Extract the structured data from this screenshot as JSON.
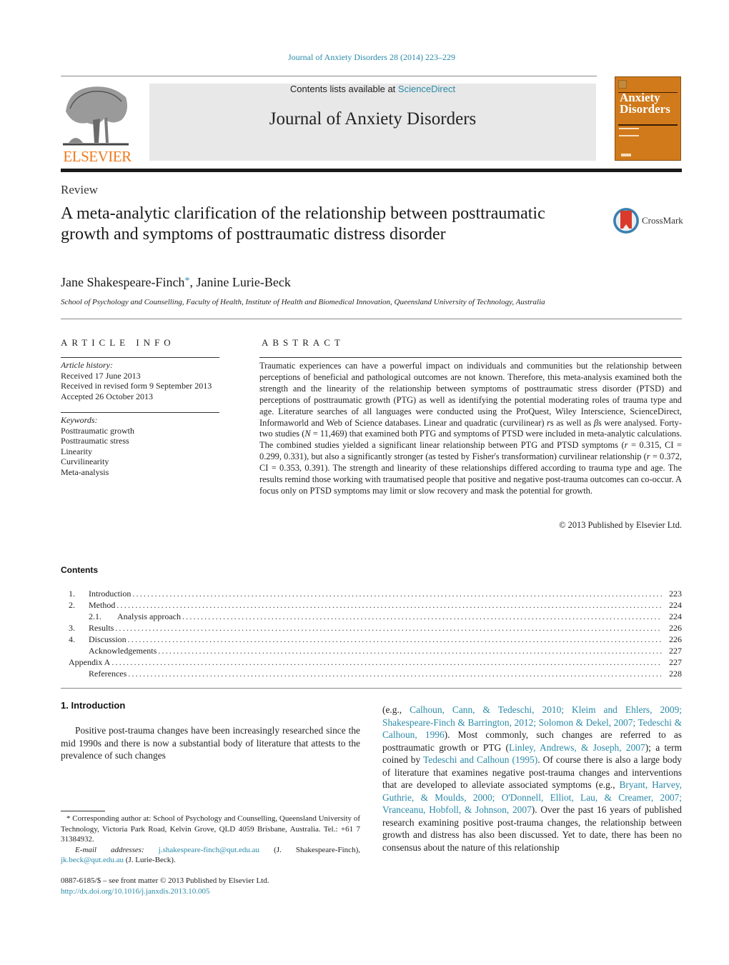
{
  "header": {
    "citation": "Journal of Anxiety Disorders 28 (2014) 223–229",
    "contents_prefix": "Contents lists available at ",
    "contents_link": "ScienceDirect",
    "journal_title": "Journal of Anxiety Disorders",
    "publisher_logo": "ELSEVIER",
    "cover": {
      "line1": "Anxiety",
      "line2": "Disorders",
      "color": "#d17a1b"
    }
  },
  "article": {
    "type": "Review",
    "title": "A meta-analytic clarification of the relationship between posttraumatic growth and symptoms of posttraumatic distress disorder",
    "crossmark_label": "CrossMark",
    "authors": [
      {
        "name": "Jane Shakespeare-Finch",
        "mark": "*"
      },
      {
        "name": "Janine Lurie-Beck",
        "mark": ""
      }
    ],
    "author_separator": ", ",
    "affiliation": "School of Psychology and Counselling, Faculty of Health, Institute of Health and Biomedical Innovation, Queensland University of Technology, Australia"
  },
  "article_info": {
    "heading": "ARTICLE INFO",
    "history_label": "Article history:",
    "history": [
      "Received 17 June 2013",
      "Received in revised form 9 September 2013",
      "Accepted 26 October 2013"
    ],
    "keywords_label": "Keywords:",
    "keywords": [
      "Posttraumatic growth",
      "Posttraumatic stress",
      "Linearity",
      "Curvilinearity",
      "Meta-analysis"
    ]
  },
  "abstract": {
    "heading": "ABSTRACT",
    "parts": [
      "Traumatic experiences can have a powerful impact on individuals and communities but the rela­tionship between perceptions of beneficial and pathological outcomes are not known. Therefore, this meta-analysis examined both the strength and the linearity of the relationship between symptoms of posttraumatic stress disorder (PTSD) and perceptions of posttraumatic growth (PTG) as well as iden­tifying the potential moderating roles of trauma type and age. Literature searches of all languages were conducted using the ProQuest, Wiley Interscience, ScienceDirect, Informaworld and Web of Sci­ence databases. Linear and quadratic (curvilinear) ",
      "r",
      "s as well as ",
      "β",
      "s were analysed. Forty-two studies (",
      "N",
      " = 11,469) that examined both PTG and symptoms of PTSD were included in meta-analytic calcula­tions. The combined studies yielded a significant linear relationship between PTG and PTSD symptoms (",
      "r",
      " = 0.315, CI = 0.299, 0.331), but also a significantly stronger (as tested by Fisher's transformation) curvi­linear relationship (",
      "r",
      " = 0.372, CI = 0.353, 0.391). The strength and linearity of these relationships differed according to trauma type and age. The results remind those working with traumatised people that posi­tive and negative post-trauma outcomes can co-occur. A focus only on PTSD symptoms may limit or slow recovery and mask the potential for growth."
    ],
    "copyright": "© 2013 Published by Elsevier Ltd."
  },
  "contents": {
    "heading": "Contents",
    "items": [
      {
        "num": "1.",
        "label": "Introduction",
        "page": "223",
        "level": 1
      },
      {
        "num": "2.",
        "label": "Method",
        "page": "224",
        "level": 1
      },
      {
        "num": "2.1.",
        "label": "Analysis approach",
        "page": "224",
        "level": 2
      },
      {
        "num": "3.",
        "label": "Results",
        "page": "226",
        "level": 1
      },
      {
        "num": "4.",
        "label": "Discussion",
        "page": "226",
        "level": 1
      },
      {
        "num": "",
        "label": "Acknowledgements",
        "page": "227",
        "level": 1
      },
      {
        "num": "",
        "label": "Appendix A",
        "page": "227",
        "level": 0
      },
      {
        "num": "",
        "label": "References",
        "page": "228",
        "level": 1
      }
    ]
  },
  "introduction": {
    "heading": "1.  Introduction",
    "col1": "Positive post-trauma changes have been increasingly researched since the mid 1990s and there is now a substan­tial body of literature that attests to the prevalence of such changes",
    "col2": [
      {
        "t": "(e.g., "
      },
      {
        "t": "Calhoun, Cann, & Tedeschi, 2010; Kleim and Ehlers, 2009; Shakespeare-Finch & Barrington, 2012; Solomon & Dekel, 2007; Tedeschi & Calhoun, 1996",
        "link": true
      },
      {
        "t": "). Most commonly, such changes are referred to as posttraumatic growth or PTG ("
      },
      {
        "t": "Linley, Andrews, & Joseph, 2007",
        "link": true
      },
      {
        "t": "); a term coined by "
      },
      {
        "t": "Tedeschi and Calhoun (1995)",
        "link": true
      },
      {
        "t": ". Of course there is also a large body of literature that examines neg­ative post-trauma changes and interventions that are developed to alleviate associated symptoms (e.g., "
      },
      {
        "t": "Bryant, Harvey, Guthrie, & Moulds, 2000; O'Donnell, Elliot, Lau, & Creamer, 2007; Vranceanu, Hobfoll, & Johnson, 2007",
        "link": true
      },
      {
        "t": "). Over the past 16 years of published research examining positive post-trauma changes, the relationship between growth and distress has also been discussed. Yet to date, there has been no consensus about the nature of this relationship"
      }
    ]
  },
  "footnote": {
    "corresponding": "* Corresponding author at: School of Psychology and Counselling, Queensland University of Technology, Victoria Park Road, Kelvin Grove, QLD 4059 Brisbane, Australia. Tel.: +61 7 31384932.",
    "email_label": "E-mail addresses: ",
    "email1": "j.shakespeare-finch@qut.edu.au",
    "email1_owner": " (J. Shakespeare-Finch),",
    "email2": "jk.beck@qut.edu.au",
    "email2_owner": " (J. Lurie-Beck).",
    "front_matter": "0887-6185/$ – see front matter © 2013 Published by Elsevier Ltd.",
    "doi": "http://dx.doi.org/10.1016/j.janxdis.2013.10.005"
  },
  "colors": {
    "link": "#2a8aa8",
    "elsevier_orange": "#f07a1c",
    "masthead_bg": "#e8e8e8"
  }
}
